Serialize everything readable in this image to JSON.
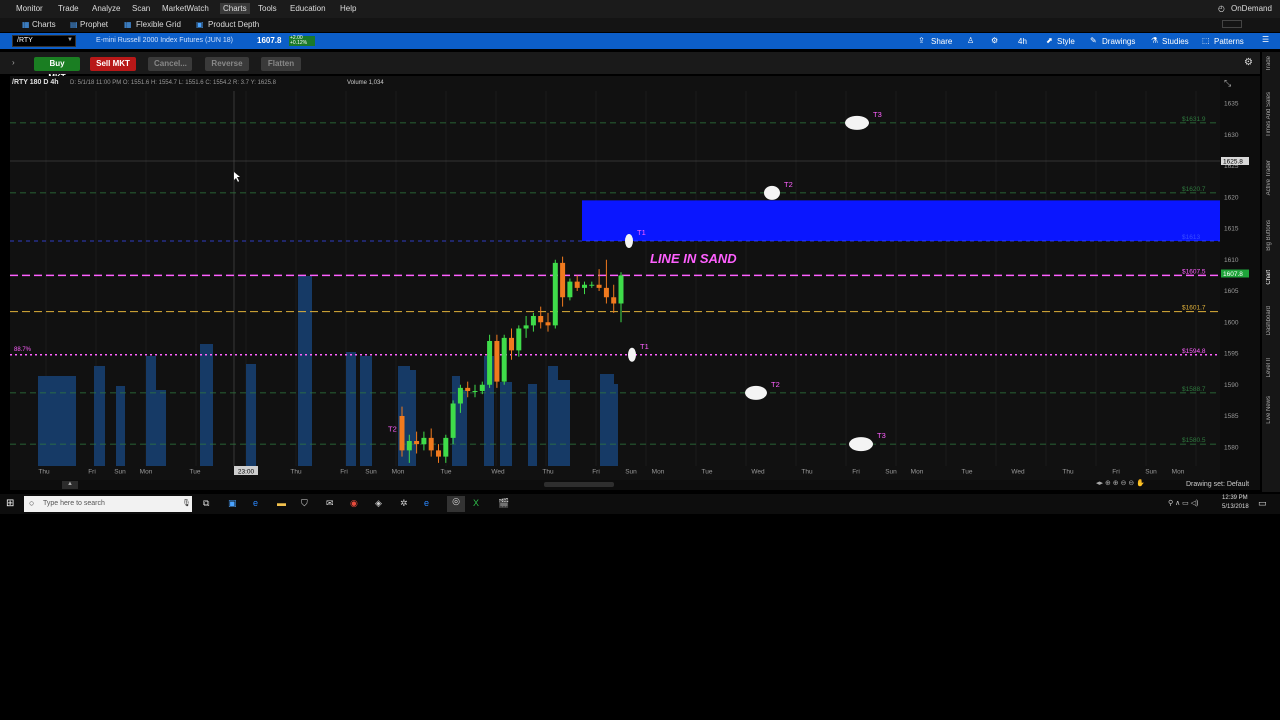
{
  "menu": {
    "items": [
      "Monitor",
      "Trade",
      "Analyze",
      "Scan",
      "MarketWatch",
      "Charts",
      "Tools",
      "Education",
      "Help"
    ],
    "active": "Charts",
    "right_label": "OnDemand"
  },
  "subtabs": [
    "Charts",
    "Prophet",
    "Flexible Grid",
    "Product Depth"
  ],
  "symbol_bar": {
    "symbol": "/RTY",
    "description": "E-mini Russell 2000 Index Futures (JUN 18)",
    "last": "1607.8",
    "change": "+2.00 +0.12%",
    "aggregation": "4h",
    "buttons": [
      "Share",
      "Style",
      "Drawings",
      "Studies",
      "Patterns"
    ]
  },
  "trade_bar": {
    "buy": "Buy MKT",
    "sell": "Sell MKT",
    "cancel": "Cancel...",
    "reverse": "Reverse",
    "flatten": "Flatten"
  },
  "chart_header": {
    "title": "/RTY 180 D 4h",
    "ohlc": "D: 5/1/18 11:00 PM  O: 1551.6  H: 1554.7  L: 1551.6  C: 1554.2  R: 3.7  Y: 1625.8",
    "volume": "Volume  1,034"
  },
  "colors": {
    "bull": "#3fdc4a",
    "bear": "#f07a1e",
    "volume": "#163a66",
    "zone": "#0a16ff",
    "magenta": "#ff60ff",
    "gold": "#e0b13a",
    "grid_green": "#2f7a3f"
  },
  "chart_data": {
    "type": "candlestick",
    "y_ticks": [
      "1635",
      "1630",
      "1625",
      "1620",
      "1615",
      "1610",
      "1605",
      "1600",
      "1595",
      "1590",
      "1585",
      "1580"
    ],
    "ylim": [
      1577,
      1637
    ],
    "x_ticks": [
      "Thu",
      "Fri",
      "Sun",
      "Mon",
      "Tue",
      "23:00",
      "Thu",
      "Fri",
      "Sun",
      "Mon",
      "Tue",
      "Wed",
      "Thu",
      "Fri",
      "Sun",
      "Mon",
      "Tue",
      "Wed",
      "Thu",
      "Fri",
      "Sun",
      "Mon",
      "Tue",
      "Wed",
      "Thu",
      "Fri",
      "Sun",
      "Mon"
    ],
    "levels": [
      {
        "label": "$1631.9",
        "value": 1631.9,
        "style": "dash-green"
      },
      {
        "label": "$1620.7",
        "value": 1620.7,
        "style": "dash-green"
      },
      {
        "label": "$1613",
        "value": 1613,
        "style": "zone-edge"
      },
      {
        "label": "$1607.5",
        "value": 1607.5,
        "style": "dash-magenta"
      },
      {
        "label": "$1601.7",
        "value": 1601.7,
        "style": "dash-gold"
      },
      {
        "label": "$1594.8",
        "value": 1594.8,
        "style": "dot-magenta"
      },
      {
        "label": "$1588.7",
        "value": 1588.7,
        "style": "dash-green"
      },
      {
        "label": "$1580.5",
        "value": 1580.5,
        "style": "dash-green"
      }
    ],
    "zone": {
      "from": 1613,
      "to": 1619.5
    },
    "current_price_tag": "1607.8",
    "cursor_price_tag": "1625.8",
    "left_label": "88.7%",
    "annotation": "LINE IN SAND",
    "targets_up": [
      "T1",
      "T2",
      "T3"
    ],
    "targets_down": [
      "T1",
      "T2",
      "T3"
    ],
    "swing_label": "T2",
    "candles": [
      {
        "o": 1585.0,
        "h": 1586.5,
        "l": 1578.5,
        "c": 1579.5
      },
      {
        "o": 1579.5,
        "h": 1582.0,
        "l": 1577.5,
        "c": 1581.0
      },
      {
        "o": 1581.0,
        "h": 1582.5,
        "l": 1579.0,
        "c": 1580.5
      },
      {
        "o": 1580.5,
        "h": 1582.5,
        "l": 1579.5,
        "c": 1581.5
      },
      {
        "o": 1581.5,
        "h": 1583.0,
        "l": 1578.5,
        "c": 1579.5
      },
      {
        "o": 1579.5,
        "h": 1580.5,
        "l": 1577.5,
        "c": 1578.5
      },
      {
        "o": 1578.5,
        "h": 1582.0,
        "l": 1577.5,
        "c": 1581.5
      },
      {
        "o": 1581.5,
        "h": 1587.5,
        "l": 1580.5,
        "c": 1587.0
      },
      {
        "o": 1587.0,
        "h": 1590.0,
        "l": 1585.5,
        "c": 1589.5
      },
      {
        "o": 1589.5,
        "h": 1590.5,
        "l": 1588.0,
        "c": 1589.0
      },
      {
        "o": 1589.0,
        "h": 1590.0,
        "l": 1588.0,
        "c": 1589.0
      },
      {
        "o": 1589.0,
        "h": 1590.5,
        "l": 1588.5,
        "c": 1590.0
      },
      {
        "o": 1590.0,
        "h": 1598.0,
        "l": 1589.5,
        "c": 1597.0
      },
      {
        "o": 1597.0,
        "h": 1598.0,
        "l": 1589.5,
        "c": 1590.5
      },
      {
        "o": 1590.5,
        "h": 1598.0,
        "l": 1590.0,
        "c": 1597.5
      },
      {
        "o": 1597.5,
        "h": 1599.0,
        "l": 1594.0,
        "c": 1595.5
      },
      {
        "o": 1595.5,
        "h": 1599.5,
        "l": 1594.5,
        "c": 1599.0
      },
      {
        "o": 1599.0,
        "h": 1601.0,
        "l": 1597.5,
        "c": 1599.5
      },
      {
        "o": 1599.5,
        "h": 1601.5,
        "l": 1598.5,
        "c": 1601.0
      },
      {
        "o": 1601.0,
        "h": 1602.5,
        "l": 1599.0,
        "c": 1600.0
      },
      {
        "o": 1600.0,
        "h": 1601.5,
        "l": 1598.5,
        "c": 1599.5
      },
      {
        "o": 1599.5,
        "h": 1610.0,
        "l": 1599.0,
        "c": 1609.5
      },
      {
        "o": 1609.5,
        "h": 1610.5,
        "l": 1602.5,
        "c": 1604.0
      },
      {
        "o": 1604.0,
        "h": 1607.0,
        "l": 1603.5,
        "c": 1606.5
      },
      {
        "o": 1606.5,
        "h": 1607.5,
        "l": 1605.0,
        "c": 1605.5
      },
      {
        "o": 1605.5,
        "h": 1606.5,
        "l": 1604.5,
        "c": 1606.0
      },
      {
        "o": 1606.0,
        "h": 1606.5,
        "l": 1605.5,
        "c": 1606.0
      },
      {
        "o": 1606.0,
        "h": 1608.5,
        "l": 1605.0,
        "c": 1605.5
      },
      {
        "o": 1605.5,
        "h": 1610.0,
        "l": 1603.0,
        "c": 1604.0
      },
      {
        "o": 1604.0,
        "h": 1606.0,
        "l": 1601.5,
        "c": 1603.0
      },
      {
        "o": 1603.0,
        "h": 1608.0,
        "l": 1600.0,
        "c": 1607.5
      }
    ]
  },
  "bottom_bar": {
    "drawing_set": "Drawing set: Default"
  },
  "side_tabs": [
    "Trade",
    "Times And Sales",
    "Active Trader",
    "Big Buttons",
    "Chart",
    "Dashboard",
    "Level II",
    "Live News"
  ],
  "taskbar": {
    "search_placeholder": "Type here to search",
    "time": "12:39 PM",
    "date": "5/13/2018"
  }
}
